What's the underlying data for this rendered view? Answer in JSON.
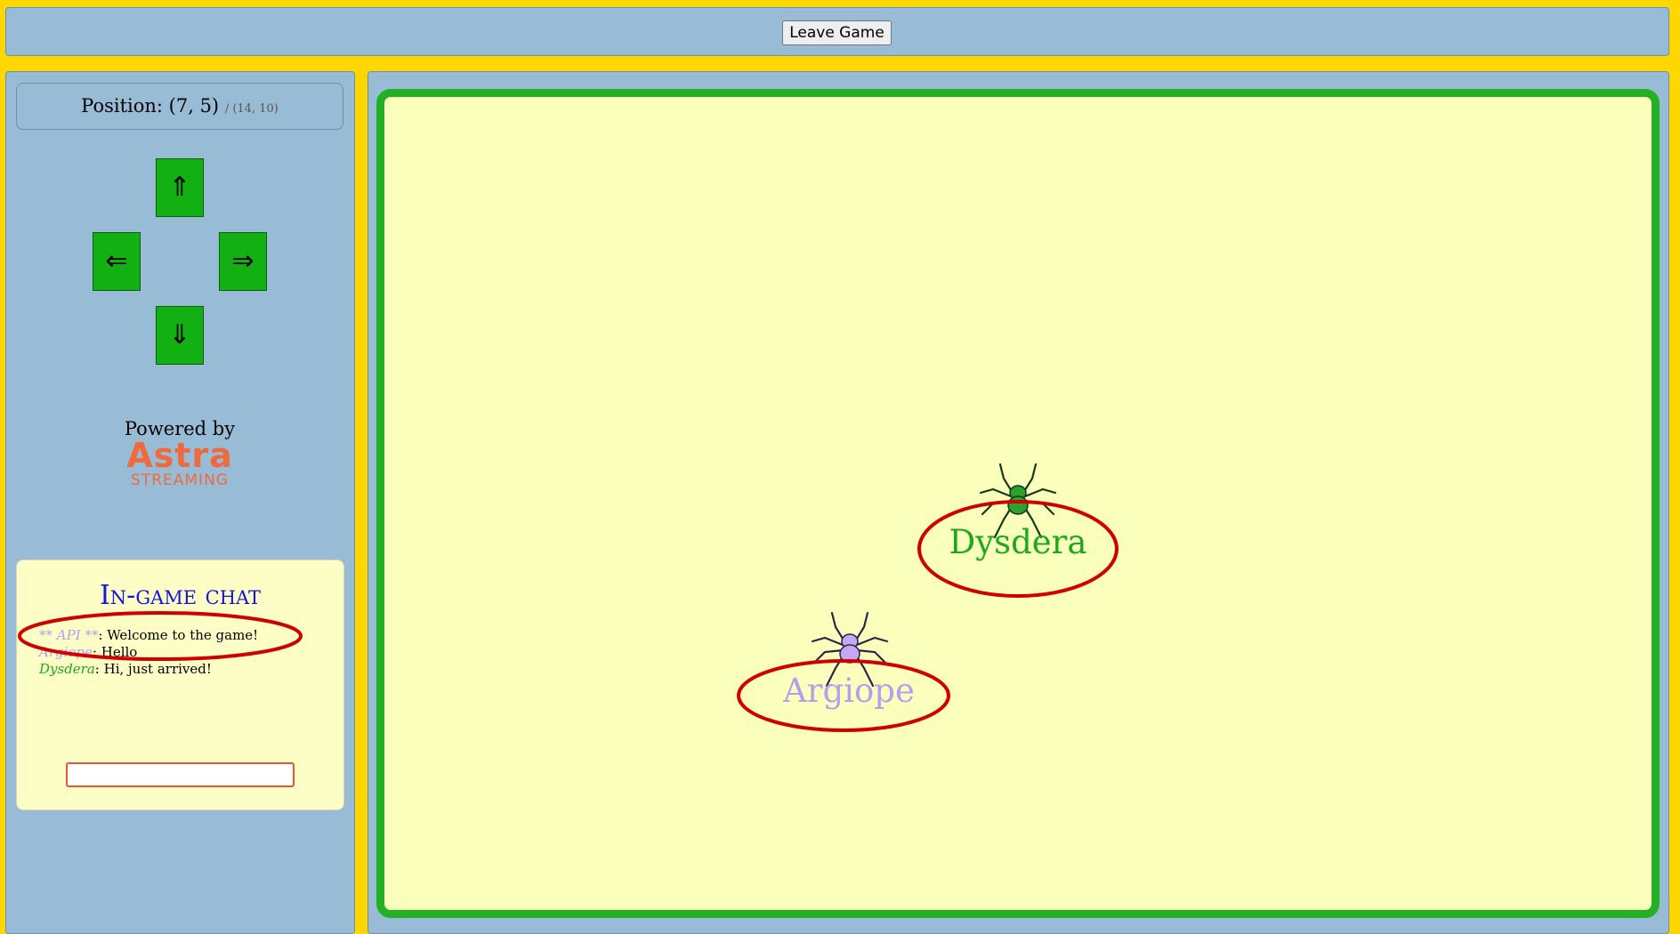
{
  "topbar": {
    "leave_label": "Leave Game"
  },
  "sidebar": {
    "position_label": "Position: (7, 5)",
    "position_max": "/ (14, 10)",
    "arrows": {
      "up": "⇑",
      "left": "⇐",
      "right": "⇒",
      "down": "⇓"
    },
    "powered_by": "Powered by",
    "logo_word": "Astra",
    "logo_sub": "STREAMING"
  },
  "chat": {
    "title": "In-game chat",
    "messages": [
      {
        "who": "** API **",
        "text": ": Welcome to the game!",
        "color": "#b89cf0"
      },
      {
        "who": "Argiope",
        "text": ": Hello",
        "color": "#b89cf0"
      },
      {
        "who": "Dysdera",
        "text": ": Hi, just arrived!",
        "color": "#1fa81f"
      }
    ],
    "input_value": ""
  },
  "players": [
    {
      "name": "Dysdera",
      "color": "#1fa81f",
      "body_color": "#2ea02e",
      "icon": "spider-icon"
    },
    {
      "name": "Argiope",
      "color": "#b89cf0",
      "body_color": "#c4a8f2",
      "icon": "spider-icon"
    }
  ],
  "colors": {
    "background": "#ffd700",
    "panel": "#98bcd6",
    "arena": "#fbffbc",
    "arena_border": "#24b024",
    "arrow_button": "#12b012",
    "highlight_ellipse": "#d00000"
  }
}
